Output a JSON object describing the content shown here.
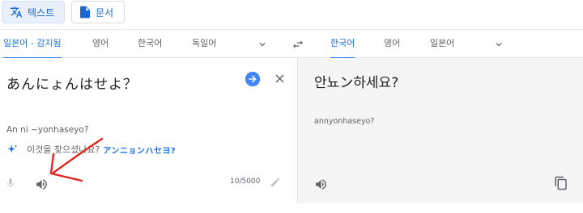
{
  "mode_tabs": {
    "text_label": "텍스트",
    "documents_label": "문서"
  },
  "source_languages": {
    "detected": "일본어 - 감지됨",
    "options": [
      "영어",
      "한국어",
      "독일어"
    ]
  },
  "target_languages": {
    "selected": "한국어",
    "options": [
      "영어",
      "일본어"
    ]
  },
  "source": {
    "text": "あんにょんはせよ？",
    "romanization": "An ni ~yonhaseyo?",
    "suggestion_prefix": "이것을 찾으셨나요?",
    "suggestion_link": "アンニョンハセヨ?",
    "char_count": "10/5000"
  },
  "target": {
    "text": "안뇨ン하세요?",
    "romanization": "annyonhaseyo?"
  },
  "colors": {
    "accent": "#1a73e8",
    "annotation_arrow": "#e52421",
    "target_panel_bg": "#f5f5f5"
  },
  "icons": {
    "mode_text": "translate-icon",
    "mode_documents": "document-icon",
    "more_source": "chevron-down-icon",
    "swap": "swap-icon",
    "more_target": "chevron-down-icon",
    "translate": "arrow-right-circle-icon",
    "clear": "close-icon",
    "sparkle": "sparkle-icon",
    "mic": "mic-icon",
    "source_listen": "speaker-icon",
    "edit": "pencil-icon",
    "target_listen": "speaker-icon",
    "copy": "copy-icon"
  }
}
